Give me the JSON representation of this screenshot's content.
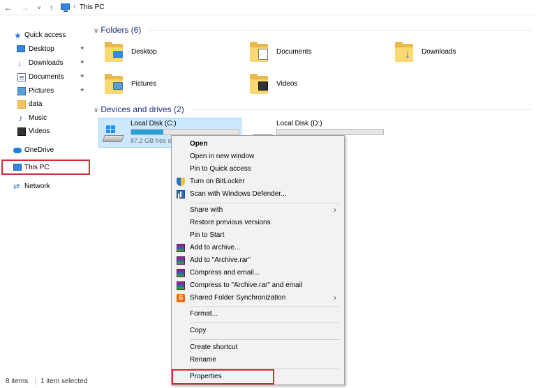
{
  "address_bar": {
    "back_glyph": "←",
    "forward_glyph": "→",
    "recent_glyph": "˅",
    "up_glyph": "↑",
    "separator": "›",
    "location": "This PC"
  },
  "sidebar": {
    "items": [
      {
        "label": "Quick access",
        "icon": "star-icon",
        "pinned": false
      },
      {
        "label": "Desktop",
        "icon": "desktop-icon",
        "pinned": true
      },
      {
        "label": "Downloads",
        "icon": "download-icon",
        "pinned": true
      },
      {
        "label": "Documents",
        "icon": "documents-icon",
        "pinned": true
      },
      {
        "label": "Pictures",
        "icon": "pictures-icon",
        "pinned": true
      },
      {
        "label": "data",
        "icon": "folder-icon",
        "pinned": false
      },
      {
        "label": "Music",
        "icon": "music-icon",
        "pinned": false
      },
      {
        "label": "Videos",
        "icon": "videos-icon",
        "pinned": false
      },
      {
        "label": "OneDrive",
        "icon": "onedrive-icon",
        "pinned": false
      },
      {
        "label": "This PC",
        "icon": "this-pc-icon",
        "pinned": false,
        "selected": true
      },
      {
        "label": "Network",
        "icon": "network-icon",
        "pinned": false
      }
    ],
    "pin_glyph": "📌"
  },
  "main": {
    "folders_header": "Folders (6)",
    "folders": [
      {
        "name": "Desktop",
        "icon": "desktop-folder-icon"
      },
      {
        "name": "Documents",
        "icon": "documents-folder-icon"
      },
      {
        "name": "Downloads",
        "icon": "downloads-folder-icon"
      },
      {
        "name": "Pictures",
        "icon": "pictures-folder-icon"
      },
      {
        "name": "Videos",
        "icon": "videos-folder-icon"
      }
    ],
    "drives_header": "Devices and drives (2)",
    "drives": [
      {
        "name": "Local Disk (C:)",
        "free_text": "87.2 GB free o",
        "used_fraction": 0.3,
        "selected": true
      },
      {
        "name": "Local Disk (D:)",
        "free_text": "",
        "used_fraction": 0.0,
        "selected": false
      }
    ]
  },
  "context_menu": {
    "items": [
      {
        "label": "Open",
        "bold": true
      },
      {
        "label": "Open in new window"
      },
      {
        "label": "Pin to Quick access"
      },
      {
        "label": "Turn on BitLocker",
        "icon": "bitlocker-shield-icon"
      },
      {
        "label": "Scan with Windows Defender...",
        "icon": "windows-defender-icon"
      },
      {
        "label": "Share with",
        "submenu": true
      },
      {
        "label": "Restore previous versions"
      },
      {
        "label": "Pin to Start"
      },
      {
        "label": "Add to archive...",
        "icon": "winrar-icon"
      },
      {
        "label": "Add to \"Archive.rar\"",
        "icon": "winrar-icon"
      },
      {
        "label": "Compress and email...",
        "icon": "winrar-icon"
      },
      {
        "label": "Compress to \"Archive.rar\" and email",
        "icon": "winrar-icon"
      },
      {
        "label": "Shared Folder Synchronization",
        "icon": "sync-icon",
        "submenu": true
      },
      {
        "label": "Format..."
      },
      {
        "label": "Copy"
      },
      {
        "label": "Create shortcut"
      },
      {
        "label": "Rename"
      },
      {
        "label": "Properties",
        "highlighted": true
      }
    ],
    "submenu_glyph": "›"
  },
  "status_bar": {
    "item_count": "8 items",
    "selection": "1 item selected"
  },
  "colors": {
    "highlight_border": "#d42b35",
    "selection_fill": "#cce8ff",
    "section_header": "#1e3287",
    "drive_bar_fill": "#26a0da"
  }
}
